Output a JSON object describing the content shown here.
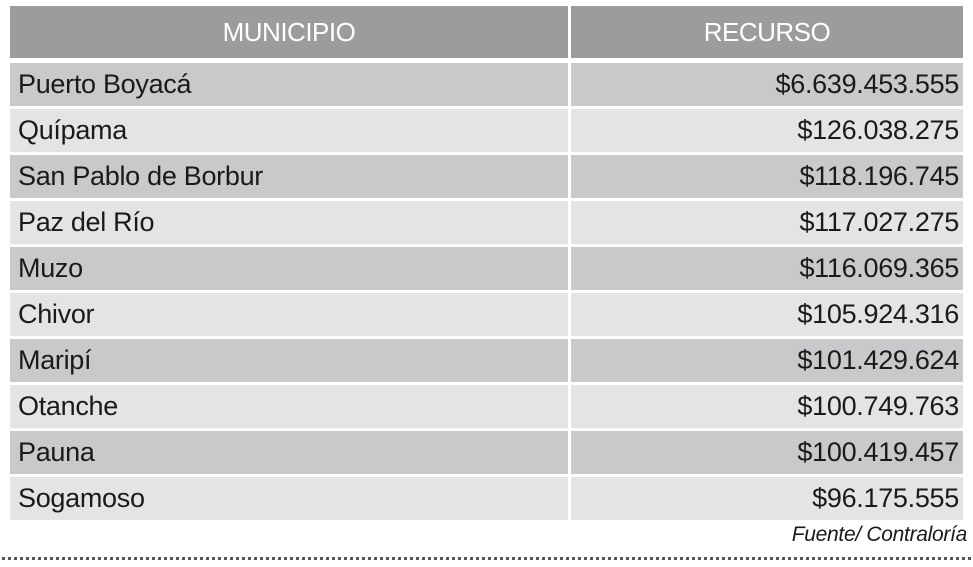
{
  "table": {
    "headers": {
      "municipio": "MUNICIPIO",
      "recurso": "RECURSO"
    },
    "rows": [
      {
        "municipio": "Puerto Boyacá",
        "recurso": "$6.639.453.555"
      },
      {
        "municipio": "Quípama",
        "recurso": "$126.038.275"
      },
      {
        "municipio": "San Pablo de Borbur",
        "recurso": "$118.196.745"
      },
      {
        "municipio": "Paz del Río",
        "recurso": "$117.027.275"
      },
      {
        "municipio": "Muzo",
        "recurso": "$116.069.365"
      },
      {
        "municipio": "Chivor",
        "recurso": "$105.924.316"
      },
      {
        "municipio": "Maripí",
        "recurso": "$101.429.624"
      },
      {
        "municipio": "Otanche",
        "recurso": "$100.749.763"
      },
      {
        "municipio": "Pauna",
        "recurso": "$100.419.457"
      },
      {
        "municipio": "Sogamoso",
        "recurso": "$96.175.555"
      }
    ]
  },
  "source": "Fuente/ Contraloría",
  "colors": {
    "header_bg": "#9b9c9e",
    "row_dark": "#c8c9cb",
    "row_light": "#e3e4e5"
  }
}
